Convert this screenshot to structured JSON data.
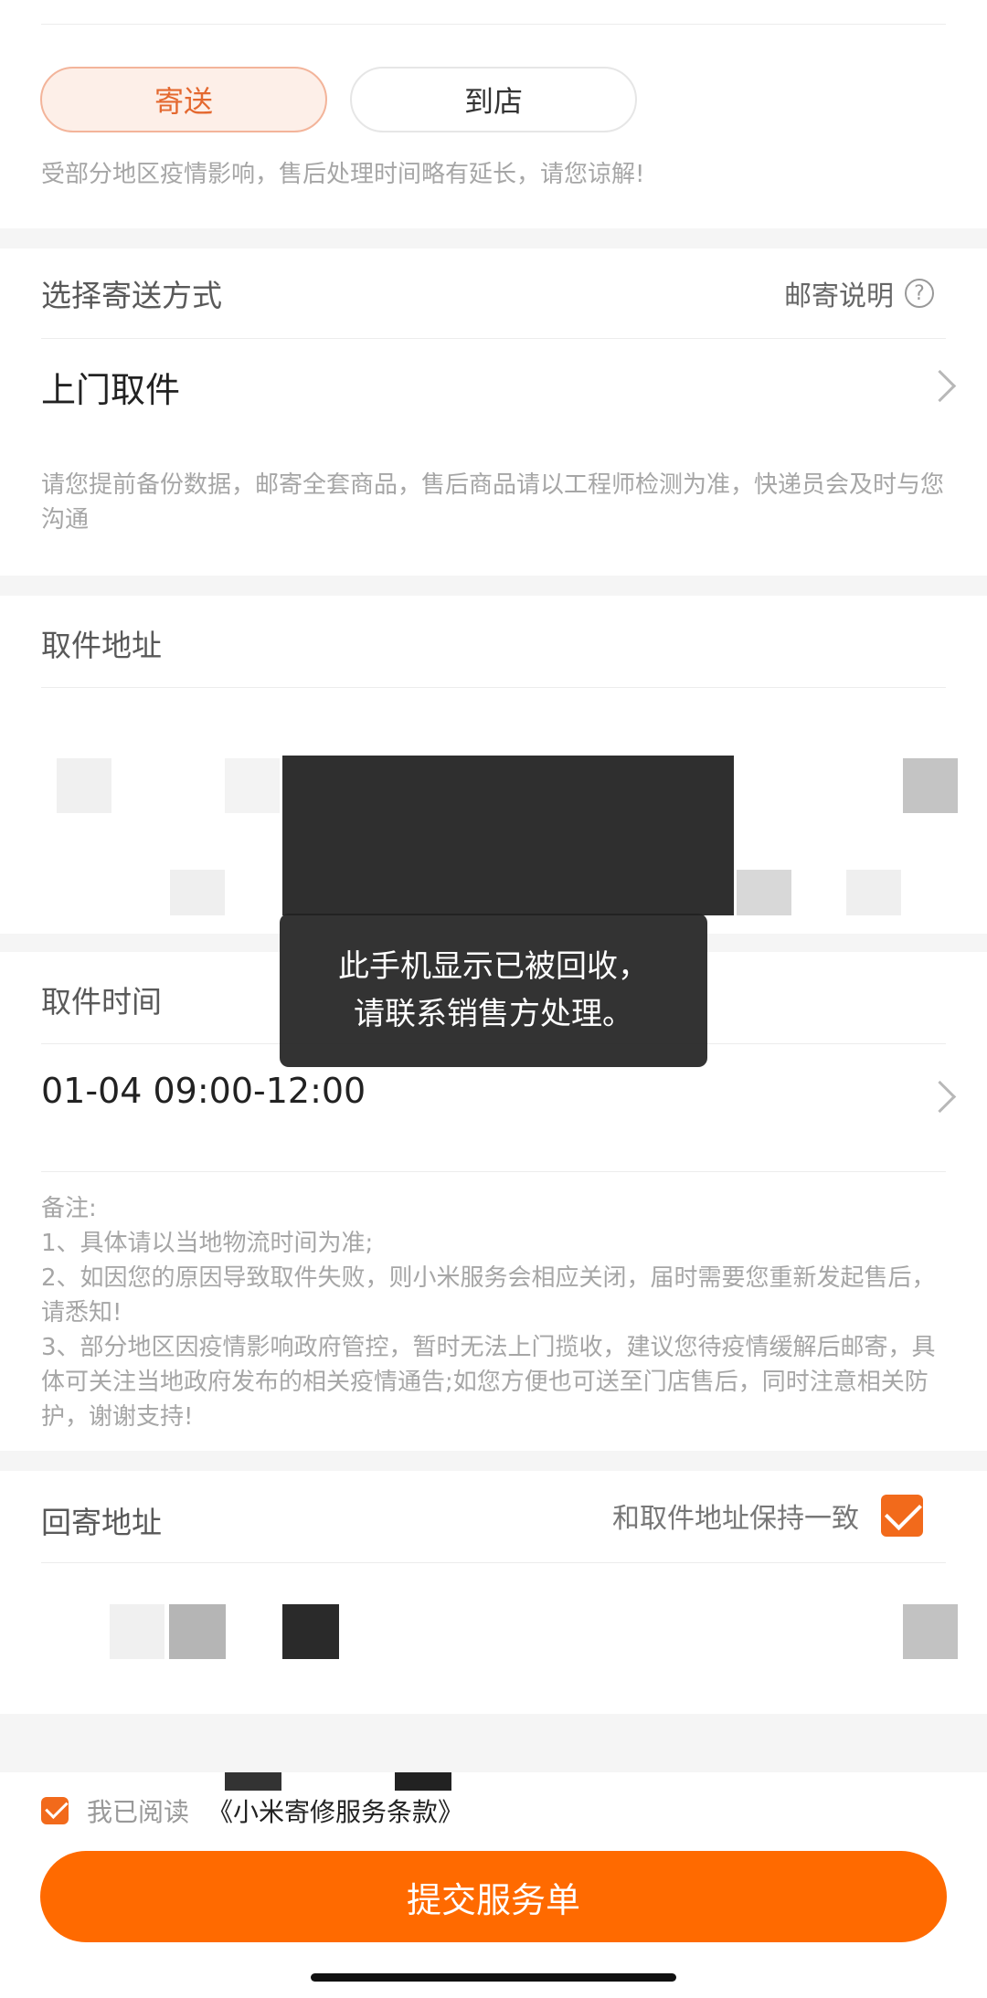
{
  "service_mode": {
    "active_label": "寄送",
    "other_label": "到店",
    "notice": "受部分地区疫情影响，售后处理时间略有延长，请您谅解!"
  },
  "shipping": {
    "section_label": "选择寄送方式",
    "help_label": "邮寄说明",
    "help_icon": "?",
    "method": "上门取件",
    "tip": "请您提前备份数据，邮寄全套商品，售后商品请以工程师检测为准，快递员会及时与您沟通"
  },
  "pickup_address": {
    "label": "取件地址"
  },
  "pickup_time": {
    "label": "取件时间",
    "value": "01-04 09:00-12:00"
  },
  "notes": {
    "title": "备注:",
    "line1": "1、具体请以当地物流时间为准;",
    "line2": "2、如因您的原因导致取件失败，则小米服务会相应关闭，届时需要您重新发起售后，请悉知!",
    "line3": "3、部分地区因疫情影响政府管控，暂时无法上门揽收，建议您待疫情缓解后邮寄，具体可关注当地政府发布的相关疫情通告;如您方便也可送至门店售后，同时注意相关防护，谢谢支持!"
  },
  "return_address": {
    "label": "回寄地址",
    "same_label": "和取件地址保持一致"
  },
  "agreement": {
    "prefix": "我已阅读",
    "link": "《小米寄修服务条款》"
  },
  "submit_label": "提交服务单",
  "toast": {
    "line1": "此手机显示已被回收，",
    "line2": "请联系销售方处理。"
  },
  "colors": {
    "accent": "#ff6a00",
    "toast_bg": "#222222"
  }
}
